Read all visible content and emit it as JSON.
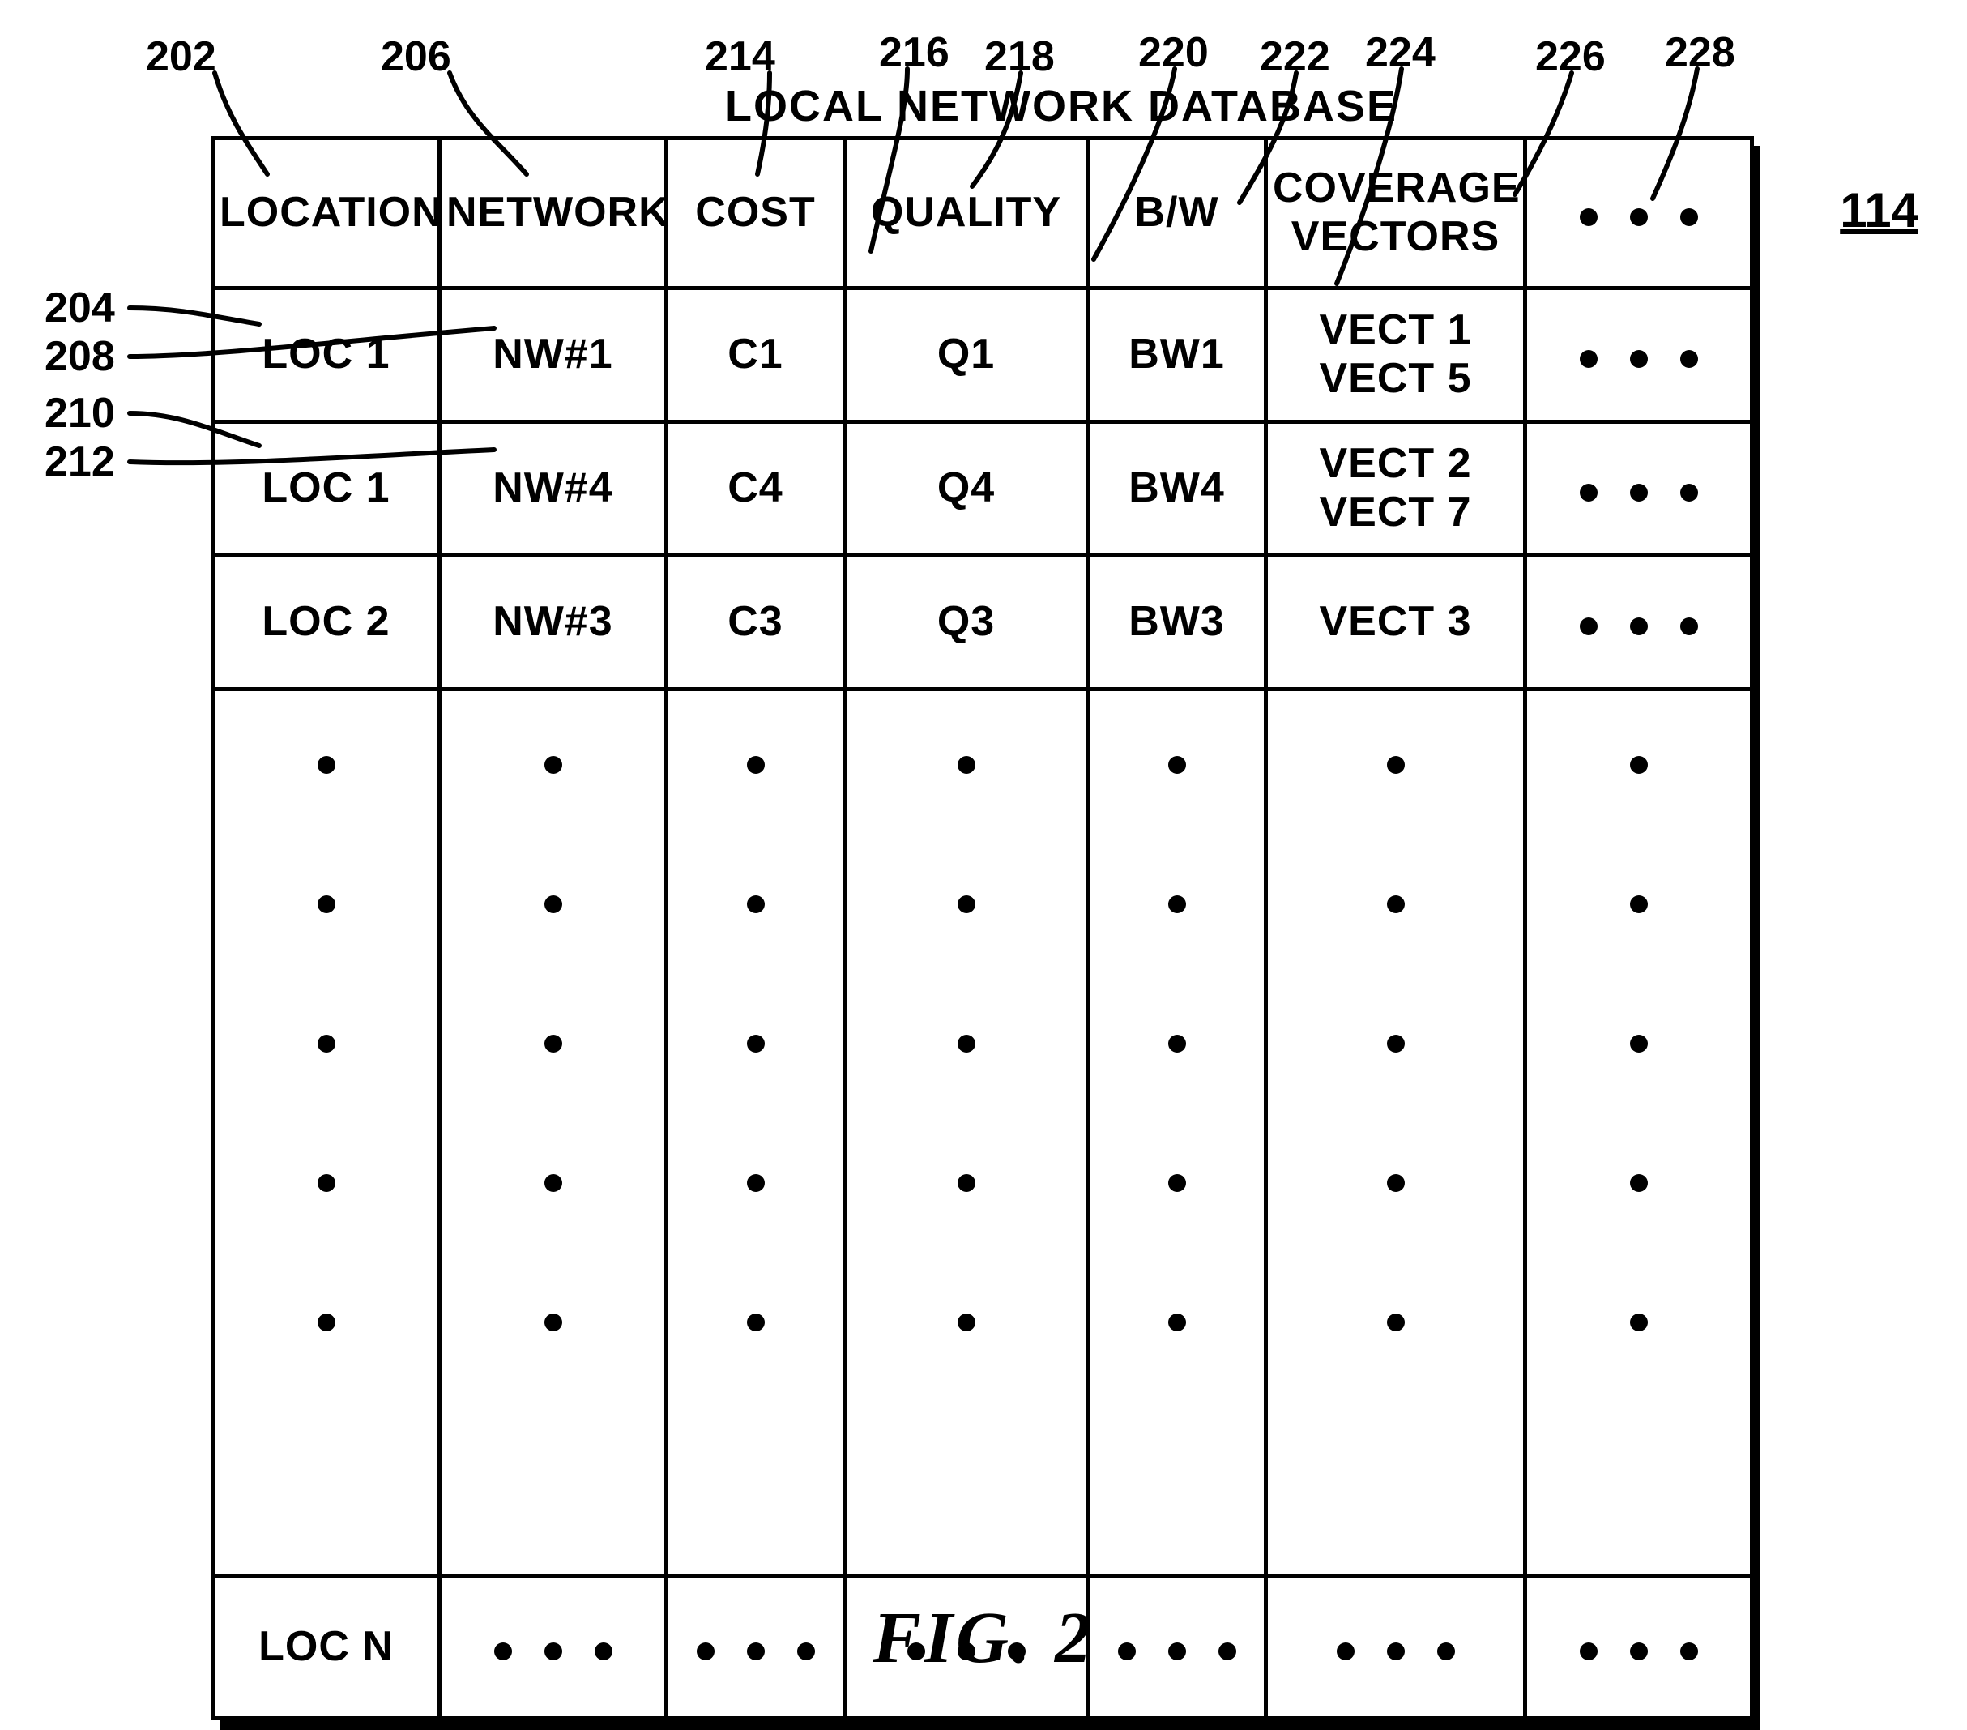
{
  "title": "LOCAL NETWORK DATABASE",
  "figure_ref": "114",
  "caption": "FIG. 2",
  "columns": {
    "location": "LOCATION",
    "network": "NETWORK",
    "cost": "COST",
    "quality": "QUALITY",
    "bw": "B/W",
    "coverage": "COVERAGE\nVECTORS",
    "more": "…"
  },
  "rows": [
    {
      "location": "LOC 1",
      "network": "NW#1",
      "cost": "C1",
      "quality": "Q1",
      "bw": "BW1",
      "coverage": "VECT 1\nVECT 5"
    },
    {
      "location": "LOC 1",
      "network": "NW#4",
      "cost": "C4",
      "quality": "Q4",
      "bw": "BW4",
      "coverage": "VECT 2\nVECT 7"
    },
    {
      "location": "LOC 2",
      "network": "NW#3",
      "cost": "C3",
      "quality": "Q3",
      "bw": "BW3",
      "coverage": "VECT 3"
    }
  ],
  "last_row_location": "LOC N",
  "refs": {
    "r202": "202",
    "r204": "204",
    "r206": "206",
    "r208": "208",
    "r210": "210",
    "r212": "212",
    "r214": "214",
    "r216": "216",
    "r218": "218",
    "r220": "220",
    "r222": "222",
    "r224": "224",
    "r226": "226",
    "r228": "228"
  }
}
